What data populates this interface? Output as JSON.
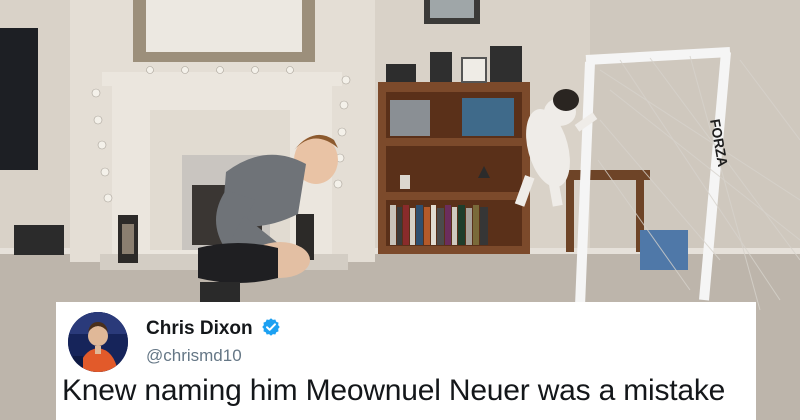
{
  "tweet": {
    "display_name": "Chris Dixon",
    "handle": "@chrismd10",
    "text": "Knew naming him Meownuel Neuer was a mistake",
    "verified": true
  },
  "colors": {
    "verified_blue": "#1da1f2",
    "name_text": "#14171a",
    "handle_text": "#657786",
    "card_background": "#ffffff"
  },
  "icons": {
    "badge": "verified-badge-icon"
  }
}
